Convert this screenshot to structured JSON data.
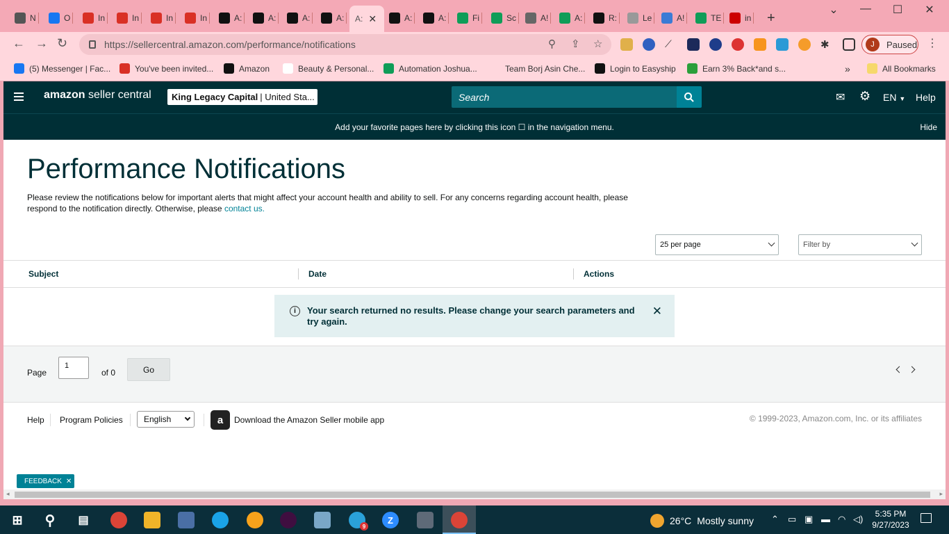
{
  "browser": {
    "tabs": [
      {
        "fav": "chrome-icon",
        "label": "N",
        "color": "#555"
      },
      {
        "fav": "facebook-icon",
        "label": "O",
        "color": "#1877f2"
      },
      {
        "fav": "gmail-icon",
        "label": "In",
        "color": "#d93025"
      },
      {
        "fav": "gmail-icon",
        "label": "In",
        "color": "#d93025"
      },
      {
        "fav": "gmail-icon",
        "label": "In",
        "color": "#d93025"
      },
      {
        "fav": "gmail-icon",
        "label": "In",
        "color": "#d93025"
      },
      {
        "fav": "amazon-icon",
        "label": "A:",
        "color": "#111"
      },
      {
        "fav": "amazon-icon",
        "label": "A:",
        "color": "#111"
      },
      {
        "fav": "amazon-icon",
        "label": "A:",
        "color": "#111"
      },
      {
        "fav": "amazon-icon",
        "label": "A:",
        "color": "#111"
      }
    ],
    "active_tab_label": "A:",
    "tabs_right": [
      {
        "fav": "amazon-icon",
        "label": "A:",
        "color": "#111"
      },
      {
        "fav": "amazon-icon",
        "label": "A:",
        "color": "#111"
      },
      {
        "fav": "sheets-icon",
        "label": "Fi",
        "color": "#0f9d58"
      },
      {
        "fav": "sheets-icon",
        "label": "Sc",
        "color": "#0f9d58"
      },
      {
        "fav": "globe-icon",
        "label": "A!",
        "color": "#666"
      },
      {
        "fav": "sheets-icon",
        "label": "A:",
        "color": "#0f9d58"
      },
      {
        "fav": "amazon-icon",
        "label": "R:",
        "color": "#111"
      },
      {
        "fav": "page-icon",
        "label": "Le",
        "color": "#999"
      },
      {
        "fav": "pen-icon",
        "label": "A!",
        "color": "#3a7bd5"
      },
      {
        "fav": "sheets-icon",
        "label": "TE",
        "color": "#0f9d58"
      },
      {
        "fav": "flag-icon",
        "label": "in",
        "color": "#c00"
      }
    ],
    "url": "https://sellercentral.amazon.com/performance/notifications",
    "profile_initial": "J",
    "profile_status": "Paused",
    "bookmarks": [
      {
        "label": "(5) Messenger | Fac...",
        "fav": "facebook-icon",
        "color": "#1877f2"
      },
      {
        "label": "You've been invited...",
        "fav": "gmail-icon",
        "color": "#d93025"
      },
      {
        "label": "Amazon",
        "fav": "amazon-icon",
        "color": "#111"
      },
      {
        "label": "Beauty & Personal...",
        "fav": "amazon-icon",
        "color": "#fff"
      },
      {
        "label": "Automation Joshua...",
        "fav": "sheets-icon",
        "color": "#0f9d58"
      },
      {
        "label": "Team Borj Asin Che...",
        "fav": "team-icon",
        "color": "#ffd7dd"
      },
      {
        "label": "Login to Easyship",
        "fav": "easyship-icon",
        "color": "#111"
      },
      {
        "label": "Earn 3% Back*and s...",
        "fav": "earn-icon",
        "color": "#2b9f3a"
      }
    ],
    "all_bookmarks": "All Bookmarks"
  },
  "seller_central": {
    "logo_a": "amazon",
    "logo_b": "seller central",
    "account_name": "King Legacy Capital",
    "account_region": "| United Sta...",
    "search_placeholder": "Search",
    "lang": "EN",
    "help": "Help",
    "fav_bar_text": "Add your favorite pages here by clicking this icon ☐ in the navigation menu.",
    "hide": "Hide"
  },
  "main": {
    "title": "Performance Notifications",
    "intro": "Please review the notifications below for important alerts that might affect your account health and ability to sell. For any concerns regarding account health, please respond to the notification directly. Otherwise, please",
    "contact_link": "contact us.",
    "per_page": "25 per page",
    "filter_placeholder": "Filter by",
    "columns": {
      "subject": "Subject",
      "date": "Date",
      "actions": "Actions"
    },
    "no_results": "Your search returned no results. Please change your search parameters and try again.",
    "pager": {
      "label": "Page",
      "value": "1",
      "of": "of 0",
      "go": "Go"
    }
  },
  "footer": {
    "help": "Help",
    "program_policies": "Program Policies",
    "language": "English",
    "app_text": "Download the Amazon Seller mobile app",
    "copyright": "© 1999-2023, Amazon.com, Inc. or its affiliates",
    "feedback": "FEEDBACK"
  },
  "taskbar": {
    "weather_temp": "26°C",
    "weather_desc": "Mostly sunny",
    "time": "5:35 PM",
    "date": "9/27/2023",
    "badge": "9"
  }
}
